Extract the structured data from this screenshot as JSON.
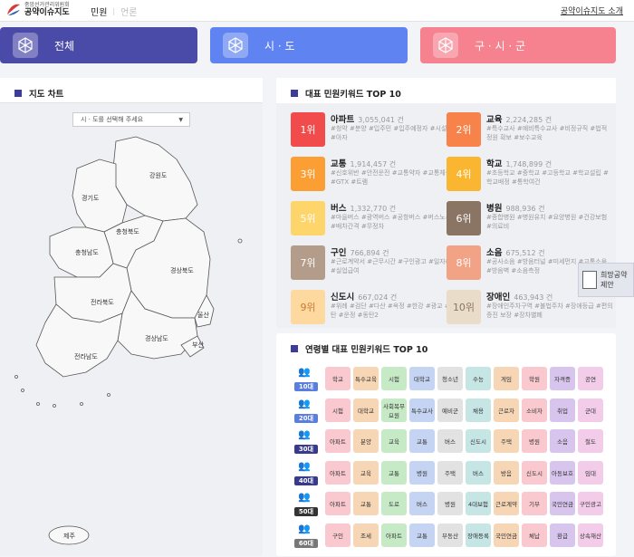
{
  "header": {
    "logo_sub": "중앙선거관리위원회",
    "logo_main": "공약이슈지도",
    "nav": [
      "민원",
      "언론"
    ],
    "intro": "공약이슈지도 소개"
  },
  "tabs": [
    {
      "label": "전체",
      "color": "#4a4aa8"
    },
    {
      "label": "시 · 도",
      "color": "#5f84f1"
    },
    {
      "label": "구 · 시 · 군",
      "color": "#f5828e"
    }
  ],
  "map": {
    "title": "지도 차트",
    "select_placeholder": "시 · 도를 선택해 주세요",
    "regions": [
      "강원도",
      "경기도",
      "충청북도",
      "충청남도",
      "경상북도",
      "전라북도",
      "경상남도",
      "전라남도",
      "울산",
      "부산",
      "제주"
    ]
  },
  "top10": {
    "title": "대표 민원키워드 TOP 10",
    "items": [
      {
        "rank": "1위",
        "keyword": "아파트",
        "count": "3,055,041 건",
        "tags": "#청약 #분양 #입주민 #입주예정자 #시설물 #아자",
        "color": "#f24b4b"
      },
      {
        "rank": "2위",
        "keyword": "교육",
        "count": "2,224,285 건",
        "tags": "#특수교사 #예비특수교사 #비정규직 #법적 정원 확보 #보수교육",
        "color": "#f7824a"
      },
      {
        "rank": "3위",
        "keyword": "교통",
        "count": "1,914,457 건",
        "tags": "#신호위반 #안전운전 #교통약자 #교통체증 #GTX #트램",
        "color": "#fb9f35"
      },
      {
        "rank": "4위",
        "keyword": "학교",
        "count": "1,748,899 건",
        "tags": "#초등학교 #중학교 #고등학교 #학교설립 #학교배정 #통학여건",
        "color": "#fbb631"
      },
      {
        "rank": "5위",
        "keyword": "버스",
        "count": "1,332,770 건",
        "tags": "#마을버스 #광역버스 #공항버스 #버스노선 #배차간격 #무정차",
        "color": "#fdd56b"
      },
      {
        "rank": "6위",
        "keyword": "병원",
        "count": "988,936 건",
        "tags": "#종합병원 #병원유치 #요양병원 #건강보험 #의료비",
        "color": "#8a7463"
      },
      {
        "rank": "7위",
        "keyword": "구인",
        "count": "766,894 건",
        "tags": "#근로계약서 #근무시간 #구인광고 #일자리 #실업급여",
        "color": "#b39c89"
      },
      {
        "rank": "8위",
        "keyword": "소음",
        "count": "675,512 건",
        "tags": "#공사소음 #방음터널 #미세먼지 #교통소음 #방음벽 #소음측정",
        "color": "#f2a285"
      },
      {
        "rank": "9위",
        "keyword": "신도시",
        "count": "667,024 건",
        "tags": "#위례 #검단 #다산 #옥정 #한강 #광교 #동탄 #운정 #동탄2",
        "color": "#fdd9a0"
      },
      {
        "rank": "10위",
        "keyword": "장애인",
        "count": "463,943 건",
        "tags": "#장애인주차구역 #불법주차 #장애등급 #편의증진 보장 #장차별폐",
        "color": "#e9dcc9"
      }
    ]
  },
  "age": {
    "title": "연령별 대표 민원키워드 TOP 10",
    "rows": [
      {
        "age": "10대",
        "color": "#5a7de0",
        "kw": [
          "학교",
          "특수교육",
          "시험",
          "대학교",
          "청소년",
          "수능",
          "게임",
          "학원",
          "자격증",
          "공연"
        ]
      },
      {
        "age": "20대",
        "color": "#5a7de0",
        "kw": [
          "시험",
          "대학교",
          "사회복무요원",
          "특수교사",
          "예비군",
          "채용",
          "근로자",
          "소비자",
          "취업",
          "군대"
        ]
      },
      {
        "age": "30대",
        "color": "#3a3a8c",
        "kw": [
          "아파트",
          "분양",
          "교육",
          "교통",
          "버스",
          "신도시",
          "주택",
          "병원",
          "소음",
          "철도"
        ]
      },
      {
        "age": "40대",
        "color": "#3a3a8c",
        "kw": [
          "아파트",
          "교육",
          "교통",
          "병원",
          "주택",
          "버스",
          "방음",
          "신도시",
          "아동보호",
          "임대"
        ]
      },
      {
        "age": "50대",
        "color": "#333333",
        "kw": [
          "아파트",
          "교통",
          "도로",
          "버스",
          "병원",
          "4대보험",
          "근로계약",
          "기부",
          "국민연금",
          "구인광고"
        ]
      },
      {
        "age": "60대",
        "color": "#777777",
        "kw": [
          "구인",
          "조세",
          "아파트",
          "교통",
          "부동산",
          "장애등록",
          "국민연금",
          "체납",
          "환급",
          "상속재산"
        ]
      }
    ]
  },
  "chip_colors": [
    "#f9c9cf",
    "#f7d6b6",
    "#c6eac6",
    "#c5d4f2",
    "#e2e2e2",
    "#c6e6e6",
    "#f7d6b6",
    "#f9c9cf",
    "#d7c5ee",
    "#f2cce9"
  ],
  "side": {
    "hope": "희망공약\n제안"
  }
}
